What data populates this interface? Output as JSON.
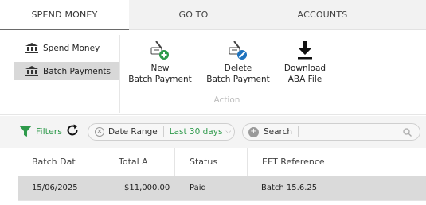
{
  "tabs": [
    {
      "label": "SPEND MONEY",
      "active": true
    },
    {
      "label": "GO TO",
      "active": false
    },
    {
      "label": "ACCOUNTS",
      "active": false
    }
  ],
  "sidebar": {
    "items": [
      {
        "label": "Spend Money",
        "icon": "bank-icon",
        "active": false
      },
      {
        "label": "Batch Payments",
        "icon": "bank-icon",
        "active": true
      }
    ]
  },
  "actions": {
    "new": {
      "line1": "New",
      "line2": "Batch Payment",
      "icon": "new-batch-icon"
    },
    "delete": {
      "line1": "Delete",
      "line2": "Batch Payment",
      "icon": "delete-batch-icon"
    },
    "download": {
      "line1": "Download",
      "line2": "ABA File",
      "icon": "download-icon"
    },
    "group_label": "Action"
  },
  "filterbar": {
    "filters_label": "Filters",
    "date_range": {
      "label": "Date Range",
      "value": "Last 30 days"
    },
    "search_label": "Search"
  },
  "table": {
    "columns": [
      "Batch Dat",
      "Total A",
      "Status",
      "EFT Reference"
    ],
    "rows": [
      {
        "date": "15/06/2025",
        "total": "$11,000.00",
        "status": "Paid",
        "eft": "Batch 15.6.25"
      }
    ]
  },
  "colors": {
    "accent_green": "#2e9a4b",
    "selected_row": "#dadada",
    "delete_blue": "#1e73be"
  }
}
